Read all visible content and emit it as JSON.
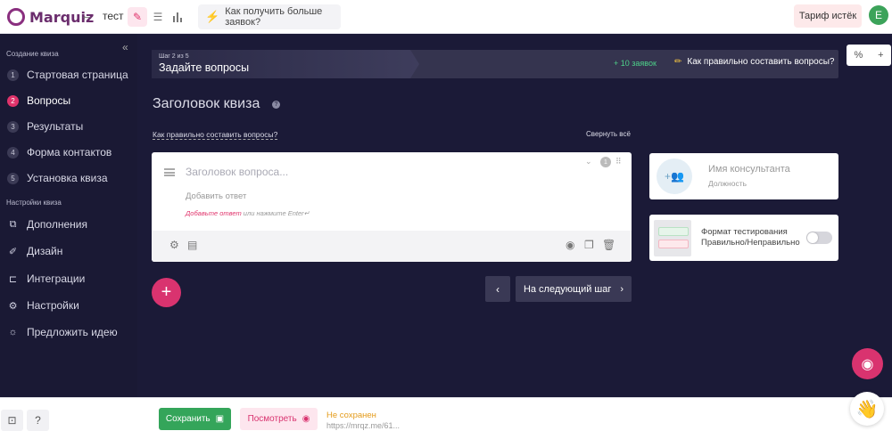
{
  "app": {
    "logo": "Marquiz"
  },
  "topbar": {
    "back_icon": "arrow-left-icon",
    "quiz_name": "тест",
    "promo_label": "Как получить больше заявок?",
    "tariff_label": "Тариф истёк",
    "avatar_letter": "E",
    "colors": {
      "accent": "#e0336b",
      "avatar": "#3ca35a"
    }
  },
  "sidebar": {
    "section1": "Создание квиза",
    "steps": [
      {
        "num": "1",
        "label": "Стартовая страница"
      },
      {
        "num": "2",
        "label": "Вопросы"
      },
      {
        "num": "3",
        "label": "Результаты"
      },
      {
        "num": "4",
        "label": "Форма контактов"
      },
      {
        "num": "5",
        "label": "Установка квиза"
      }
    ],
    "section2": "Настройки квиза",
    "settings": [
      {
        "label": "Дополнения",
        "icon": "puzzle-icon"
      },
      {
        "label": "Дизайн",
        "icon": "brush-icon"
      },
      {
        "label": "Интеграции",
        "icon": "integration-icon"
      },
      {
        "label": "Настройки",
        "icon": "gear-icon"
      },
      {
        "label": "Предложить идею",
        "icon": "bulb-icon"
      }
    ]
  },
  "stepbar": {
    "small": "Шаг 2 из 5",
    "title": "Задайте вопросы",
    "leads": "+ 10 заявок",
    "help": "Как правильно составить вопросы?"
  },
  "main": {
    "quiz_title": "Заголовок квиза",
    "how_link": "Как правильно составить вопросы?",
    "collapse_all": "Свернуть всё",
    "question": {
      "placeholder": "Заголовок вопроса...",
      "add_answer": "Добавить ответ",
      "hint_link": "Добавьте ответ",
      "hint_rest": " или нажмите Enter↵",
      "badge": "1"
    },
    "next_label": "На следующий шаг"
  },
  "consultant": {
    "name": "Имя консультанта",
    "position": "Должность"
  },
  "test_format": {
    "line1": "Формат тестирования",
    "line2": "Правильно/Неправильно",
    "enabled": false
  },
  "bottombar": {
    "save_label": "Сохранить",
    "view_label": "Посмотреть",
    "status": "Не сохранен",
    "url": "https://mrqz.me/61..."
  }
}
